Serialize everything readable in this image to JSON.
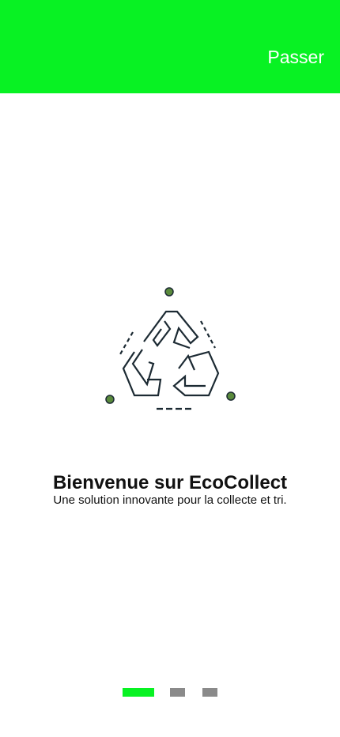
{
  "header": {
    "skip_label": "Passer",
    "background_color": "#08f223"
  },
  "illustration": {
    "icon": "recycle-icon",
    "stroke_color": "#1c2a33",
    "accent_color": "#5a8a3c"
  },
  "onboarding": {
    "title": "Bienvenue sur EcoCollect",
    "subtitle": "Une solution innovante pour la collecte et tri."
  },
  "pager": {
    "total_pages": 3,
    "active_index": 0,
    "active_color": "#08f223",
    "inactive_color": "#8a8a8a"
  }
}
